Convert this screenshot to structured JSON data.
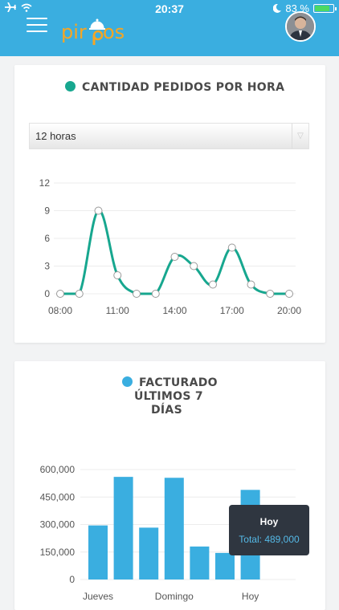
{
  "status": {
    "time": "20:37",
    "battery": "83 %",
    "battery_level": 0.83,
    "icons": [
      "airplane-icon",
      "wifi-icon",
      "moon-icon",
      "battery-icon"
    ]
  },
  "header": {
    "logo": "pirpos",
    "menu_icon": "hamburger-icon",
    "colors": {
      "bar": "#3aaee0",
      "logo": "#f6a623"
    }
  },
  "orders_card": {
    "title": "CANTIDAD PEDIDOS POR HORA",
    "dot_color": "#17a78f",
    "select_value": "12 horas",
    "chart_data": {
      "type": "line",
      "x": [
        "08:00",
        "09:00",
        "10:00",
        "11:00",
        "12:00",
        "13:00",
        "14:00",
        "15:00",
        "16:00",
        "17:00",
        "18:00",
        "19:00",
        "20:00"
      ],
      "values": [
        0,
        0,
        9,
        2,
        0,
        0,
        4,
        3,
        1,
        5,
        1,
        0,
        0
      ],
      "x_tick_labels": [
        "08:00",
        "11:00",
        "14:00",
        "17:00",
        "20:00"
      ],
      "y_ticks": [
        "12",
        "9",
        "6",
        "3",
        "0"
      ],
      "ylim": [
        0,
        12
      ],
      "grid": true,
      "color": "#17a78f"
    }
  },
  "billing_card": {
    "title_lines": [
      "FACTURADO",
      "ÚLTIMOS 7",
      "DÍAS"
    ],
    "dot_color": "#3aaee0",
    "chart_data": {
      "type": "bar",
      "categories": [
        "Jueves",
        "Viernes",
        "Sábado",
        "Domingo",
        "Lunes",
        "Martes",
        "Hoy"
      ],
      "visible_category_labels": [
        "Jueves",
        "Domingo",
        "Hoy"
      ],
      "values": [
        295000,
        560000,
        283000,
        555000,
        180000,
        145000,
        489000
      ],
      "y_ticks": [
        "600,000",
        "450,000",
        "300,000",
        "150,000",
        "0"
      ],
      "ylim": [
        0,
        600000
      ],
      "grid": true,
      "color": "#3aaee0"
    },
    "tooltip": {
      "title": "Hoy",
      "text": "Total: 489,000"
    }
  }
}
